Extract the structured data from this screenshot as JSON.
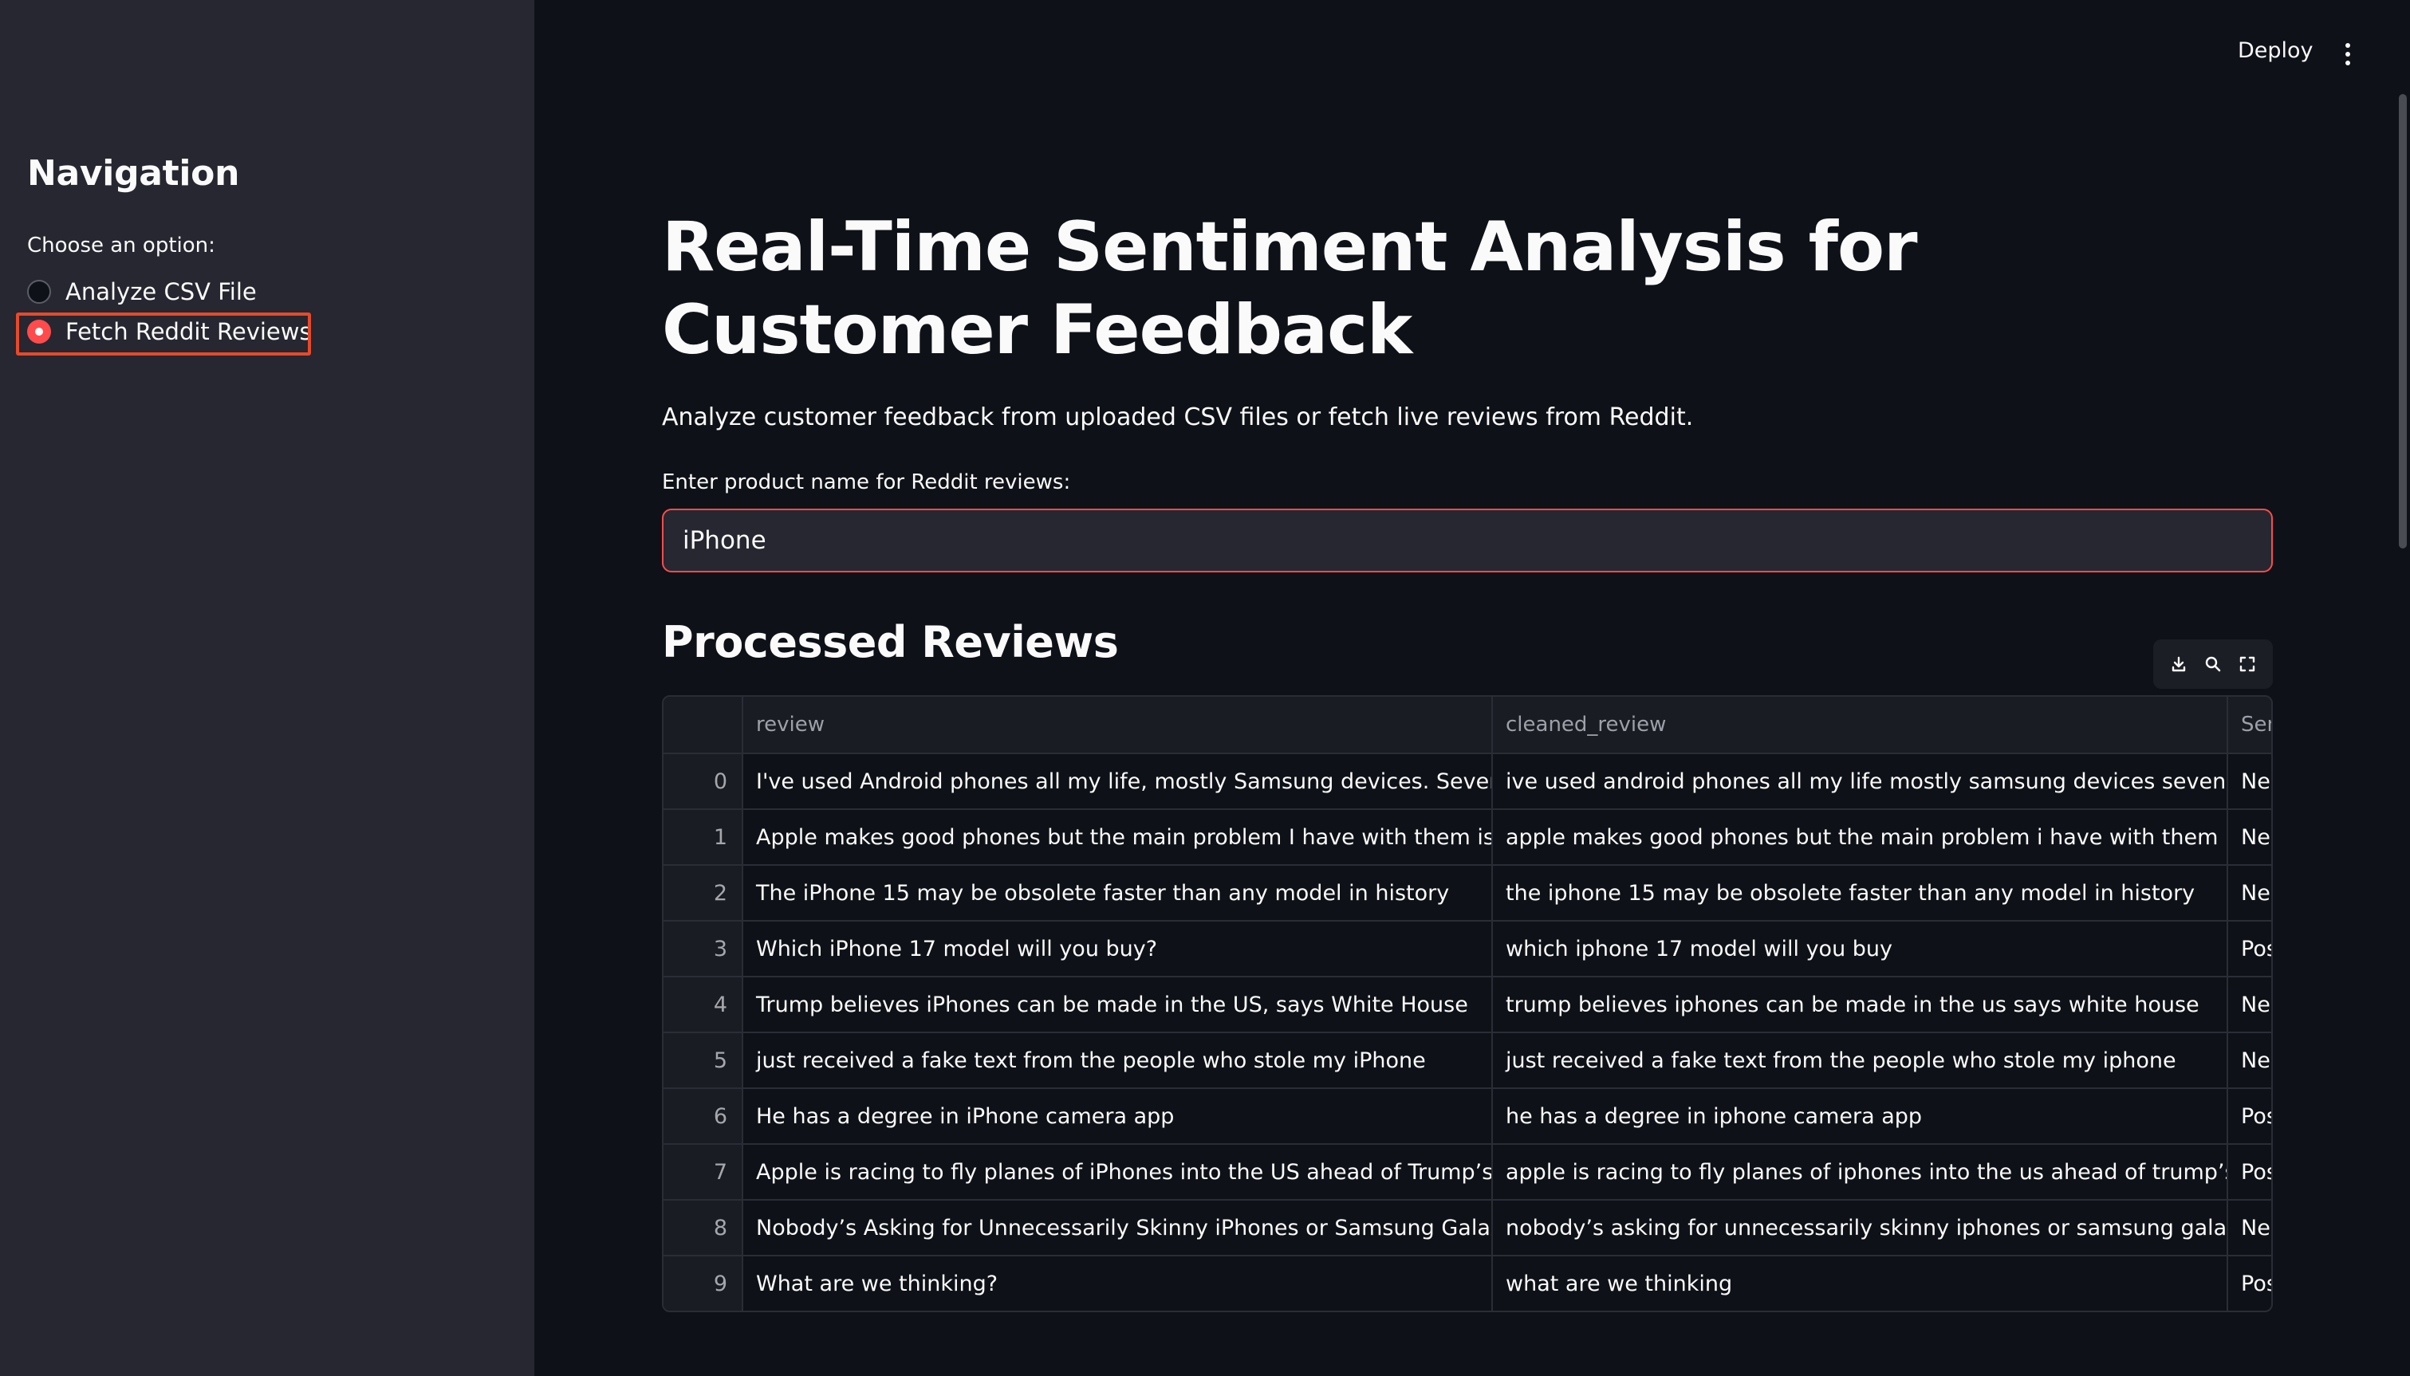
{
  "sidebar": {
    "title": "Navigation",
    "radio_label": "Choose an option:",
    "options": [
      {
        "label": "Analyze CSV File",
        "selected": false
      },
      {
        "label": "Fetch Reddit Reviews",
        "selected": true
      }
    ]
  },
  "header": {
    "deploy_label": "Deploy",
    "menu_icon": "kebab-menu-icon"
  },
  "main": {
    "title": "Real-Time Sentiment Analysis for Customer Feedback",
    "subtitle": "Analyze customer feedback from uploaded CSV files or fetch live reviews from Reddit.",
    "input_label": "Enter product name for Reddit reviews:",
    "input_value": "iPhone",
    "section_title": "Processed Reviews"
  },
  "table": {
    "columns": [
      "",
      "review",
      "cleaned_review",
      "Sen"
    ],
    "rows": [
      {
        "index": "0",
        "review": "I've used Android phones all my life, mostly Samsung devices. Seven months ag",
        "cleaned_review": "ive used android phones all my life mostly samsung devices seven months ago",
        "sentiment": "Neg"
      },
      {
        "index": "1",
        "review": "Apple makes good phones but the main problem I have with them is the price ar",
        "cleaned_review": "apple makes good phones but the main problem i have with them is the price",
        "sentiment": "Neg"
      },
      {
        "index": "2",
        "review": "The iPhone 15 may be obsolete faster than any model in history",
        "cleaned_review": "the iphone 15 may be obsolete faster than any model in history",
        "sentiment": "Neg"
      },
      {
        "index": "3",
        "review": "Which iPhone 17 model will you buy?",
        "cleaned_review": "which iphone 17 model will you buy",
        "sentiment": "Pos"
      },
      {
        "index": "4",
        "review": "Trump believes iPhones can be made in the US, says White House",
        "cleaned_review": "trump believes iphones can be made in the us says white house",
        "sentiment": "Neg"
      },
      {
        "index": "5",
        "review": "just received a fake text from the people who stole my iPhone",
        "cleaned_review": "just received a fake text from the people who stole my iphone",
        "sentiment": "Neg"
      },
      {
        "index": "6",
        "review": "He has a degree in iPhone camera app",
        "cleaned_review": "he has a degree in iphone camera app",
        "sentiment": "Pos"
      },
      {
        "index": "7",
        "review": "Apple is racing to fly planes of iPhones into the US ahead of Trump’s tariffs",
        "cleaned_review": "apple is racing to fly planes of iphones into the us ahead of trump’s tariffs",
        "sentiment": "Pos"
      },
      {
        "index": "8",
        "review": "Nobody’s Asking for Unnecessarily Skinny iPhones or Samsung Galaxy Phones",
        "cleaned_review": "nobody’s asking for unnecessarily skinny iphones or samsung galaxy phones",
        "sentiment": "Neg"
      },
      {
        "index": "9",
        "review": "What are we thinking?",
        "cleaned_review": "what are we thinking",
        "sentiment": "Pos"
      }
    ]
  },
  "toolbar_icons": [
    "download-icon",
    "search-icon",
    "fullscreen-icon"
  ],
  "colors": {
    "accent": "#ff4b4b",
    "highlight": "#e8492b",
    "sidebar_bg": "#262730",
    "main_bg": "#0e1117"
  }
}
